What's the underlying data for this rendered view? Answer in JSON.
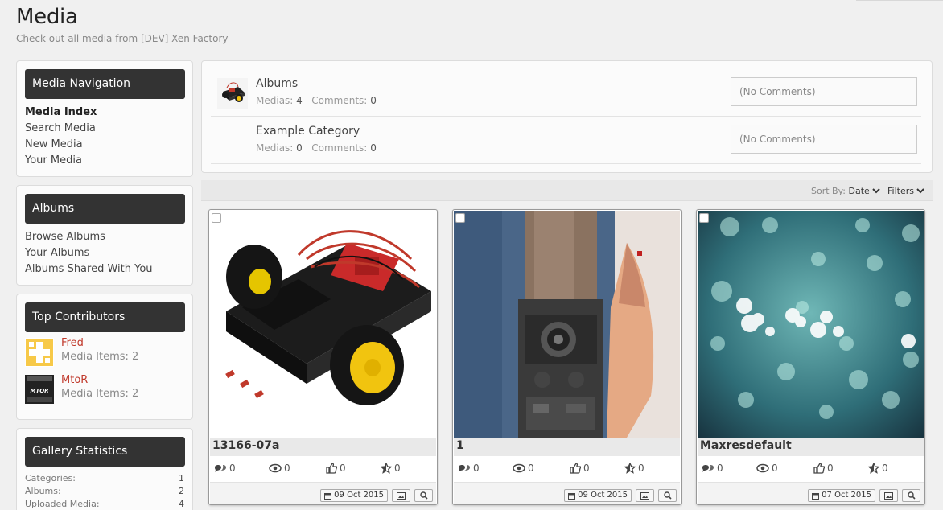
{
  "page": {
    "title": "Media",
    "subtitle": "Check out all media from [DEV] Xen Factory"
  },
  "media_nav": {
    "title": "Media Navigation",
    "items": [
      "Media Index",
      "Search Media",
      "New Media",
      "Your Media"
    ],
    "current": "Media Index"
  },
  "albums_nav": {
    "title": "Albums",
    "items": [
      "Browse Albums",
      "Your Albums",
      "Albums Shared With You"
    ]
  },
  "top_contributors": {
    "title": "Top Contributors",
    "users": [
      {
        "name": "Fred",
        "info": "Media Items: 2"
      },
      {
        "name": "MtoR",
        "info": "Media Items: 2",
        "avatar_text": "MTOR"
      }
    ]
  },
  "gallery_stats": {
    "title": "Gallery Statistics",
    "rows": [
      {
        "label": "Categories:",
        "value": "1"
      },
      {
        "label": "Albums:",
        "value": "2"
      },
      {
        "label": "Uploaded Media:",
        "value": "4"
      }
    ]
  },
  "categories": [
    {
      "title": "Albums",
      "medias_label": "Medias:",
      "medias": "4",
      "comments_label": "Comments:",
      "comments": "0",
      "last_comment": "(No Comments)"
    },
    {
      "title": "Example Category",
      "medias_label": "Medias:",
      "medias": "0",
      "comments_label": "Comments:",
      "comments": "0",
      "last_comment": "(No Comments)"
    }
  ],
  "sort_bar": {
    "sort_label": "Sort By:",
    "sort_value": "Date",
    "filters_label": "Filters"
  },
  "media_items": [
    {
      "title": "13166-07a",
      "comments": "0",
      "views": "0",
      "likes": "0",
      "rating": "0",
      "date": "09 Oct 2015"
    },
    {
      "title": "1",
      "comments": "0",
      "views": "0",
      "likes": "0",
      "rating": "0",
      "date": "09 Oct 2015"
    },
    {
      "title": "Maxresdefault",
      "comments": "0",
      "views": "0",
      "likes": "0",
      "rating": "0",
      "date": "07 Oct 2015"
    }
  ],
  "icons": {
    "comments": "comments-icon",
    "views": "eye-icon",
    "likes": "thumbs-up-icon",
    "rating": "star-icon",
    "date": "calendar-icon",
    "image": "image-icon",
    "zoom": "zoom-icon",
    "sort": "chevron-down-icon"
  },
  "colors": {
    "header_block": "#333333",
    "username_link": "#c0392b",
    "background": "#f0f0f0"
  }
}
